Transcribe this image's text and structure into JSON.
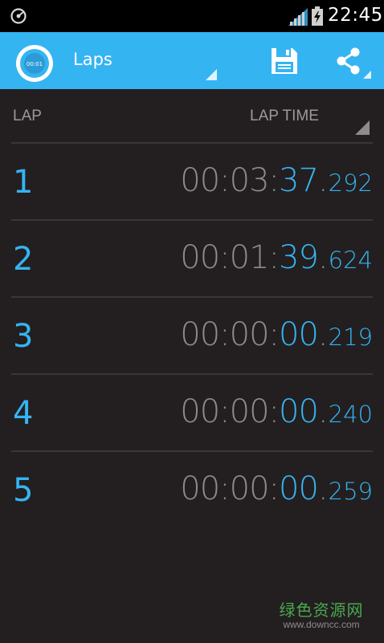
{
  "status_bar": {
    "time": "22:45",
    "left_icon": "stopwatch-notification-icon",
    "signal_icon": "signal-icon",
    "battery_icon": "battery-charging-icon"
  },
  "app_bar": {
    "title": "Laps",
    "logo_icon": "stopwatch-logo-icon",
    "logo_text": "00:01",
    "save_icon": "save-icon",
    "share_icon": "share-icon",
    "bg_color": "#35b4f2"
  },
  "table": {
    "header_lap": "LAP",
    "header_lap_time": "LAP TIME",
    "laps": [
      {
        "number": "1",
        "hm": "00:03:",
        "sec": "37",
        "dot": ".",
        "ms": "292"
      },
      {
        "number": "2",
        "hm": "00:01:",
        "sec": "39",
        "dot": ".",
        "ms": "624"
      },
      {
        "number": "3",
        "hm": "00:00:",
        "sec": "00",
        "dot": ".",
        "ms": "219"
      },
      {
        "number": "4",
        "hm": "00:00:",
        "sec": "00",
        "dot": ".",
        "ms": "240"
      },
      {
        "number": "5",
        "hm": "00:00:",
        "sec": "00",
        "dot": ".",
        "ms": "259"
      }
    ]
  },
  "watermark": {
    "cn": "绿色资源网",
    "url": "www.downcc.com"
  },
  "colors": {
    "accent": "#35b4f2",
    "background": "#231f20",
    "muted_text": "#8f8a8b"
  }
}
